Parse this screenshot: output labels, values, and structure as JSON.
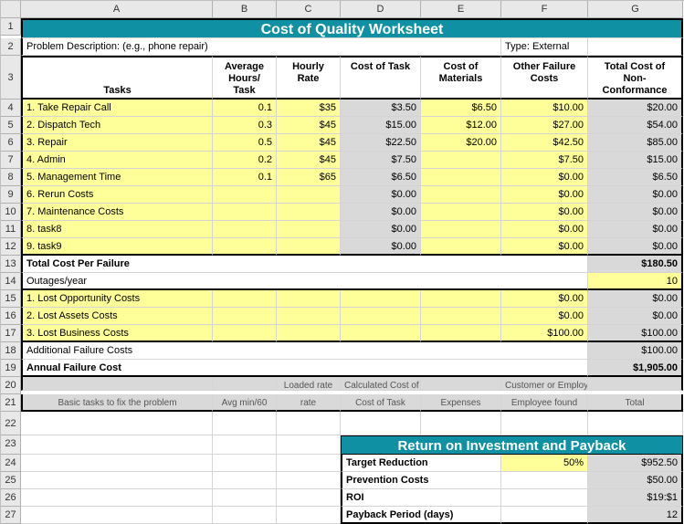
{
  "cols": [
    "A",
    "B",
    "C",
    "D",
    "E",
    "F",
    "G"
  ],
  "rows": [
    "1",
    "2",
    "3",
    "4",
    "5",
    "6",
    "7",
    "8",
    "9",
    "10",
    "11",
    "12",
    "13",
    "14",
    "15",
    "16",
    "17",
    "18",
    "19",
    "20",
    "21",
    "22",
    "23",
    "24",
    "25",
    "26",
    "27"
  ],
  "title": "Cost of Quality Worksheet",
  "r2": {
    "desc": "Problem Description: (e.g., phone repair)",
    "type": "Type: External"
  },
  "h3": {
    "tasks": "Tasks",
    "avg": "Average Hours/ Task",
    "rate": "Hourly Rate",
    "cot": "Cost of Task",
    "com": "Cost of Materials",
    "ofc": "Other Failure Costs",
    "tcnc": "Total Cost of Non-Conformance"
  },
  "tasks": [
    {
      "n": "1. Take Repair Call",
      "h": "0.1",
      "r": "$35",
      "ct": "$3.50",
      "cm": "$6.50",
      "of": "$10.00",
      "tc": "$20.00"
    },
    {
      "n": "2. Dispatch Tech",
      "h": "0.3",
      "r": "$45",
      "ct": "$15.00",
      "cm": "$12.00",
      "of": "$27.00",
      "tc": "$54.00"
    },
    {
      "n": "3. Repair",
      "h": "0.5",
      "r": "$45",
      "ct": "$22.50",
      "cm": "$20.00",
      "of": "$42.50",
      "tc": "$85.00"
    },
    {
      "n": "4. Admin",
      "h": "0.2",
      "r": "$45",
      "ct": "$7.50",
      "cm": "",
      "of": "$7.50",
      "tc": "$15.00"
    },
    {
      "n": "5. Management Time",
      "h": "0.1",
      "r": "$65",
      "ct": "$6.50",
      "cm": "",
      "of": "$0.00",
      "tc": "$6.50"
    },
    {
      "n": "6. Rerun Costs",
      "h": "",
      "r": "",
      "ct": "$0.00",
      "cm": "",
      "of": "$0.00",
      "tc": "$0.00"
    },
    {
      "n": "7. Maintenance Costs",
      "h": "",
      "r": "",
      "ct": "$0.00",
      "cm": "",
      "of": "$0.00",
      "tc": "$0.00"
    },
    {
      "n": "8. task8",
      "h": "",
      "r": "",
      "ct": "$0.00",
      "cm": "",
      "of": "$0.00",
      "tc": "$0.00"
    },
    {
      "n": "9. task9",
      "h": "",
      "r": "",
      "ct": "$0.00",
      "cm": "",
      "of": "$0.00",
      "tc": "$0.00"
    }
  ],
  "r13": {
    "l": "Total Cost Per Failure",
    "v": "$180.50"
  },
  "r14": {
    "l": "Outages/year",
    "v": "10"
  },
  "lost": [
    {
      "n": "1. Lost Opportunity Costs",
      "f": "$0.00",
      "g": "$0.00"
    },
    {
      "n": "2. Lost Assets Costs",
      "f": "$0.00",
      "g": "$0.00"
    },
    {
      "n": "3. Lost Business Costs",
      "f": "$100.00",
      "g": "$100.00"
    }
  ],
  "r18": {
    "l": "Additional Failure Costs",
    "v": "$100.00"
  },
  "r19": {
    "l": "Annual Failure Cost",
    "v": "$1,905.00"
  },
  "r21": {
    "a": "Basic tasks to fix the problem",
    "b": "Avg min/60",
    "c": "Loaded rate",
    "d": "Calculated Cost of Task",
    "e": "Expenses",
    "f": "Customer or Employee found",
    "g": "Total"
  },
  "roiTitle": "Return on Investment and Payback",
  "roi": [
    {
      "l": "Target Reduction",
      "f": "50%",
      "g": "$952.50",
      "yel": true
    },
    {
      "l": "Prevention Costs",
      "f": "",
      "g": "$50.00",
      "yel": false
    },
    {
      "l": "ROI",
      "f": "",
      "g": "$19:$1",
      "yel": false
    },
    {
      "l": "Payback Period (days)",
      "f": "",
      "g": "12",
      "yel": false
    }
  ]
}
